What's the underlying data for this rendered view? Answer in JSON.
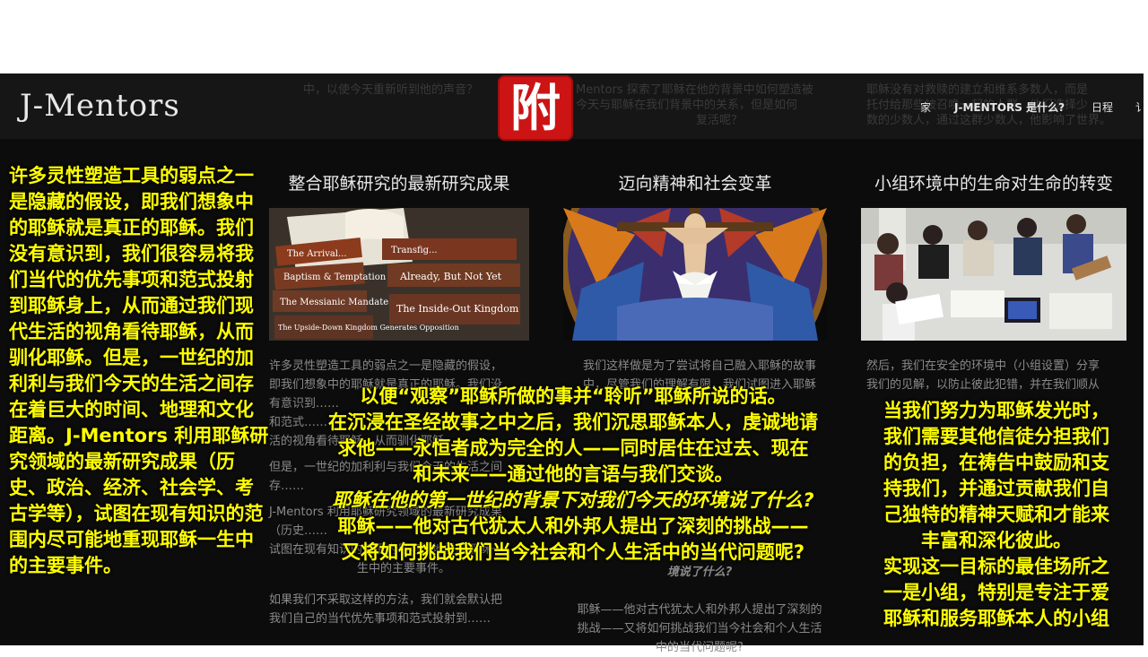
{
  "site": {
    "logo": "J-Mentors",
    "menu": [
      "家",
      "J-MENTORS 是什么?",
      "日程",
      "讠"
    ],
    "badge": "附",
    "ghost": [
      "中，以使今天重新听到他的声音？",
      "Mentors 探索了耶稣在他的背景中如何塑造被",
      "今天与耶稣在我们背景中的关系，但是如何",
      "复活呢？",
      "耶稣没有对救赎的建立和维系多数人，而是",
      "托付给那些被召唤一起的人群，他们选择少",
      "数的少数人，通过这群少数人，他影响了世界。"
    ]
  },
  "columns": [
    {
      "title": "整合耶稣研究的最新研究成果",
      "photo_alt": "cards-and-bible",
      "card_labels": [
        "The Arrival...",
        "Baptism & Temptation",
        "The Messianic Mandate",
        "The Upside-Down Kingdom Generates Opposition",
        "Transfig...",
        "Already, But Not Yet",
        "The Inside-Out Kingdom"
      ],
      "body_lines": [
        "许多灵性塑造工具的弱点之一是隐藏的假设，",
        "即我们想象中的耶稣就是真正的耶稣。我们没",
        "有意识到……",
        "和范式……",
        "活的视角看待耶稣，从而驯化耶稣。",
        "",
        "但是，一世纪的加利利与我们今天的生活之间",
        "存……",
        "",
        "J-Mentors 利用耶稣研究领域的最新研究成果",
        "（历史……",
        "试图在现有知识的范围内尽可能地重现耶稣一",
        "生中的主要事件。",
        "",
        "如果我们不采取这样的方法，我们就会默认把",
        "我们自己的当代优先事项和范式投射到……"
      ]
    },
    {
      "title": "迈向精神和社会变革",
      "photo_alt": "stained-glass-crucifix",
      "body_lines": [
        "我们这样做是为了尝试将自己融入耶稣的故事",
        "中，尽管我们的理解有限，我们试图进入耶稣",
        "……",
        "……",
        "……",
        "……",
        "……",
        "……",
        "……",
        "……",
        "……",
        "……",
        "境说了什么?",
        "",
        "耶稣——他对古代犹太人和外邦人提出了深刻的",
        "挑战——又将如何挑战我们当今社会和个人生活",
        "中的当代问题呢?"
      ]
    },
    {
      "title": "小组环境中的生命对生命的转变",
      "photo_alt": "small-group-study",
      "body_lines": [
        "然后，我们在安全的环境中（小组设置）分享",
        "我们的见解，以防止彼此犯错，并在我们顺从",
        "……",
        "……",
        "……",
        "……",
        "……",
        "……",
        "……",
        "……",
        "……",
        "并通过……",
        "……",
        "专注于爱耶稣和服务耶稣本人的小组。"
      ]
    }
  ],
  "overlays": {
    "left": "许多灵性塑造工具的弱点之一是隐藏的假设，即我们想象中的耶稣就是真正的耶稣。我们没有意识到，我们很容易将我们当代的优先事项和范式投射到耶稣身上，从而通过我们现代生活的视角看待耶稣，从而驯化耶稣。但是，一世纪的加利利与我们今天的生活之间存在着巨大的时间、地理和文化距离。J-Mentors 利用耶稣研究领域的最新研究成果（历史、政治、经济、社会学、考古学等），试图在现有知识的范围内尽可能地重现耶稣一生中的主要事件。",
    "center_lines": [
      "以便“观察”耶稣所做的事并“聆听”耶稣所说的话。",
      "在沉浸在圣经故事之中之后，我们沉思耶稣本人，虔诚地请",
      "求他——永恒者成为完全的人——同时居住在过去、现在",
      "和未来——通过他的言语与我们交谈。"
    ],
    "center_italic": "耶稣在他的第一世纪的背景下对我们今天的环境说了什么?",
    "center_lines2": [
      "耶稣——他对古代犹太人和外邦人提出了深刻的挑战——",
      "又将如何挑战我们当今社会和个人生活中的当代问题呢?"
    ],
    "right_lines": [
      "当我们努力为耶稣发光时，",
      "我们需要其他信徒分担我们",
      "的负担，在祷告中鼓励和支",
      "持我们，并通过贡献我们自",
      "己独特的精神天赋和才能来",
      "丰富和深化彼此。",
      "实现这一目标的最佳场所之",
      "一是小组，特别是专注于爱",
      "耶稣和服务耶稣本人的小组"
    ]
  },
  "colors": {
    "overlay_text": "#ffff00",
    "background": "#0c0c0c",
    "badge": "#cc1414"
  }
}
